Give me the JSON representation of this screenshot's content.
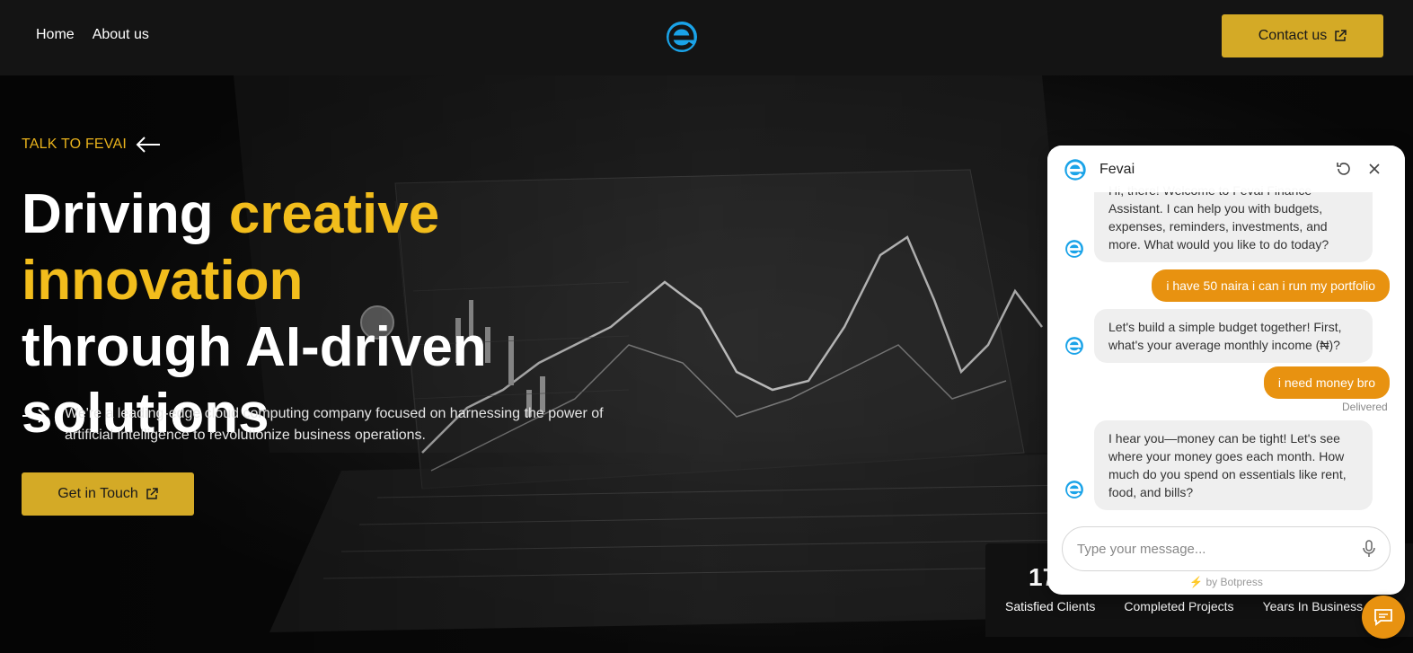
{
  "nav": {
    "links": [
      "Home",
      "About us"
    ],
    "contact_label": "Contact us",
    "logo_icon": "e-logo-icon"
  },
  "hero": {
    "eyebrow": "TALK TO FEVAI",
    "headline_part1": "Driving ",
    "headline_accent": "creative innovation",
    "headline_part2": "through AI-driven solutions",
    "description": "We're a leading-edge cloud computing company focused on harnessing the power of artificial intelligence to revolutionize business operations.",
    "cta_label": "Get in Touch",
    "stats_number": "17",
    "stats_labels": [
      "Satisfied Clients",
      "Completed Projects",
      "Years In Business"
    ]
  },
  "chat": {
    "title": "Fevai",
    "messages": [
      {
        "role": "bot",
        "text": "Hi, there! Welcome to Fevai Finance Assistant. I can help you with budgets, expenses, reminders, investments, and more. What would you like to do today?"
      },
      {
        "role": "user",
        "text": "i have 50 naira i can i run my portfolio"
      },
      {
        "role": "bot",
        "text": "Let's build a simple budget together! First, what's your average monthly income (₦)?"
      },
      {
        "role": "user",
        "text": "i need money bro"
      },
      {
        "role": "bot",
        "text": "I hear you—money can be tight! Let's see where your money goes each month. How much do you spend on essentials like rent, food, and bills?"
      }
    ],
    "delivered": "Delivered",
    "input_placeholder": "Type your message...",
    "powered_by": "by Botpress"
  },
  "colors": {
    "accent_gold": "#d4aa26",
    "headline_accent": "#f2bd1c",
    "chat_orange": "#e89210",
    "logo_blue": "#1aa3e8"
  }
}
